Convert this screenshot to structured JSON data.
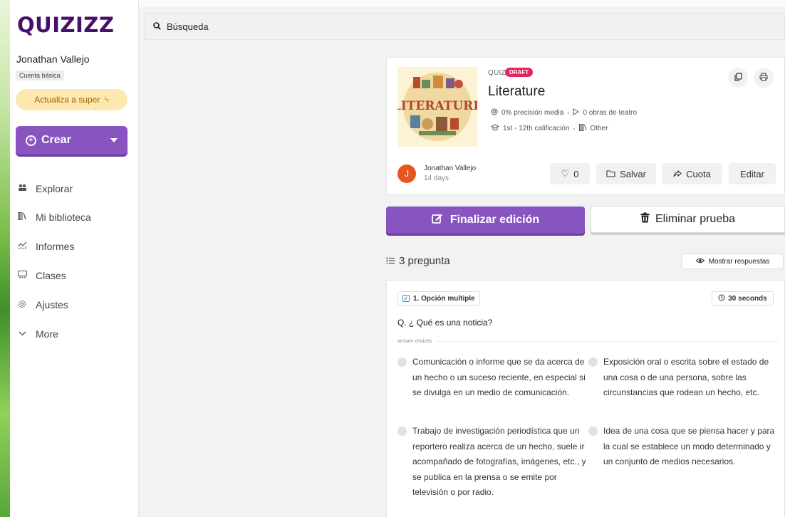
{
  "sidebar": {
    "logo": "QUIZIZZ",
    "user_name": "Jonathan Vallejo",
    "plan": "Cuenta básica",
    "upgrade_label": "Actualiza a super",
    "create_label": "Crear",
    "nav": [
      {
        "label": "Explorar",
        "icon": "explore-icon"
      },
      {
        "label": "Mi biblioteca",
        "icon": "library-icon"
      },
      {
        "label": "Informes",
        "icon": "reports-icon"
      },
      {
        "label": "Clases",
        "icon": "classes-icon"
      },
      {
        "label": "Ajustes",
        "icon": "settings-icon"
      },
      {
        "label": "More",
        "icon": "chevron-down-icon"
      }
    ]
  },
  "search": {
    "placeholder": "Búsqueda"
  },
  "quiz": {
    "type_label": "QUIZ",
    "status": "DRAFT",
    "title": "Literature",
    "cover_text": "LITERATURE",
    "accuracy": "0% precisión media",
    "plays": "0 obras de teatro",
    "grades": "1st - 12th calificación",
    "subject": "Other",
    "author_initial": "J",
    "author": "Jonathan Vallejo",
    "date": "14 days",
    "likes": "0",
    "save_label": "Salvar",
    "share_label": "Cuota",
    "edit_label": "Editar"
  },
  "actions": {
    "finish_label": "Finalizar edición",
    "delete_label": "Eliminar prueba"
  },
  "questions_header": {
    "count_label": "3 pregunta",
    "show_answers_label": "Mostrar respuestas"
  },
  "question": {
    "type": "1. Opción multiple",
    "time": "30 seconds",
    "text": "Q. ¿ Qué es una noticia?",
    "choices_label": "answer choices",
    "choices": [
      "Comunicación o informe que se da acerca de un hecho o un suceso reciente, en especial si se divulga en un medio de comunicación.",
      "Exposición oral o escrita sobre el estado de una cosa o de una persona, sobre las circunstancias que rodean un hecho, etc.",
      "Trabajo de investigación periodística que un reportero realiza acerca de un hecho, suele ir acompañado de fotografías, imágenes, etc., y se publica en la prensa o se emite por televisión o por radio.",
      "Idea de una cosa que se piensa hacer y para la cual se establece un modo determinado y un conjunto de medios necesarios."
    ]
  },
  "colors": {
    "brand": "#46106b",
    "primary": "#8854c0",
    "draft": "#e5245e",
    "upgrade_bg": "#fde8b0",
    "avatar": "#e8551f"
  }
}
